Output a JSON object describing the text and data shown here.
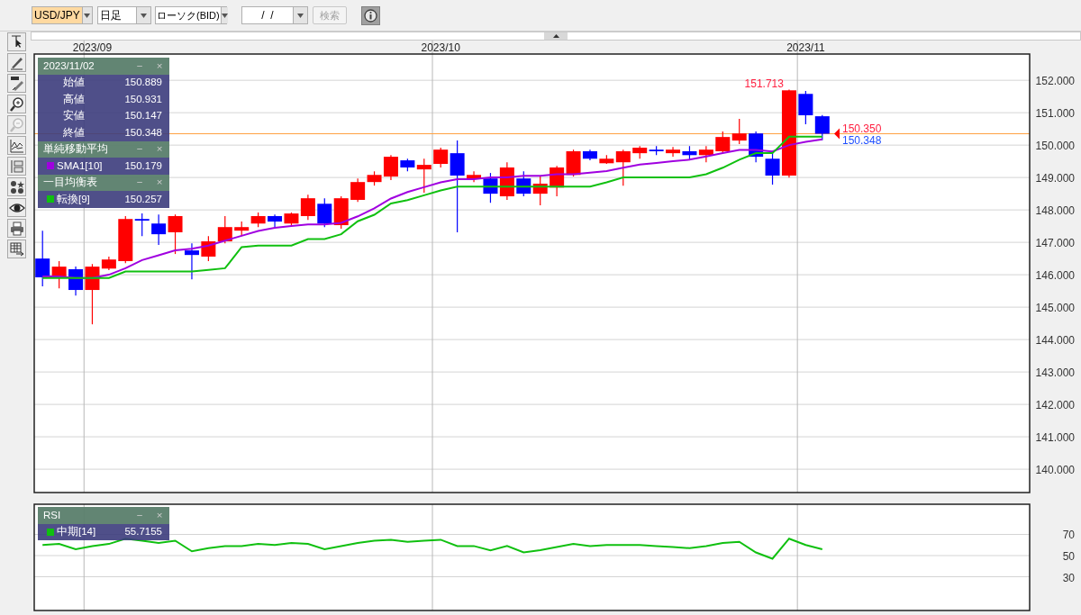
{
  "toolbar": {
    "symbol": "USD/JPY",
    "timeframe": "日足",
    "chart_type": "ローソク(BID)",
    "date": "/  /",
    "search_button": "検索",
    "search_disabled": true
  },
  "price_chart": {
    "legends": [
      {
        "title": "2023/11/02",
        "minimize": "−",
        "close": "×",
        "rows": [
          {
            "kind": "value",
            "label": "始値",
            "value": "150.889"
          },
          {
            "kind": "value",
            "label": "高値",
            "value": "150.931"
          },
          {
            "kind": "value",
            "label": "安値",
            "value": "150.147"
          },
          {
            "kind": "value",
            "label": "終値",
            "value": "150.348"
          }
        ]
      },
      {
        "title": "単純移動平均",
        "minimize": "−",
        "close": "×",
        "rows": [
          {
            "kind": "series",
            "value": "150.179"
          }
        ]
      },
      {
        "title": "一目均衡表",
        "minimize": "−",
        "close": "×",
        "rows": [
          {
            "kind": "series",
            "value": "150.257"
          }
        ]
      }
    ],
    "chart_data": {
      "type": "candlestick",
      "grid": true,
      "ylim": [
        139.28,
        152.81
      ],
      "categories": [
        null,
        null,
        null,
        "2023/09",
        null,
        null,
        null,
        null,
        null,
        null,
        null,
        null,
        null,
        null,
        null,
        null,
        null,
        null,
        null,
        null,
        null,
        null,
        null,
        null,
        "2023/10",
        null,
        null,
        null,
        null,
        null,
        null,
        null,
        null,
        null,
        null,
        null,
        null,
        null,
        null,
        null,
        null,
        null,
        null,
        null,
        null,
        null,
        "2023/11",
        null,
        null,
        null,
        null,
        null,
        null,
        null,
        null,
        null,
        null,
        null,
        null,
        null
      ],
      "yticks": [
        {
          "value": 152,
          "label": "152.000"
        },
        {
          "value": 151,
          "label": "151.000"
        },
        {
          "value": 150,
          "label": "150.000"
        },
        {
          "value": 149,
          "label": "149.000"
        },
        {
          "value": 148,
          "label": "148.000"
        },
        {
          "value": 147,
          "label": "147.000"
        },
        {
          "value": 146,
          "label": "146.000"
        },
        {
          "value": 145,
          "label": "145.000"
        },
        {
          "value": 144,
          "label": "144.000"
        },
        {
          "value": 143,
          "label": "143.000"
        },
        {
          "value": 142,
          "label": "142.000"
        },
        {
          "value": 141,
          "label": "141.000"
        },
        {
          "value": 140,
          "label": "140.000"
        }
      ],
      "ohlc": [
        [
          146.5,
          147.36,
          145.64,
          145.92
        ],
        [
          145.92,
          146.42,
          145.58,
          146.25
        ],
        [
          146.17,
          146.25,
          145.36,
          145.53
        ],
        [
          145.53,
          146.33,
          144.47,
          146.25
        ],
        [
          146.19,
          146.56,
          146.14,
          146.47
        ],
        [
          146.42,
          147.81,
          146.36,
          147.72
        ],
        [
          147.72,
          147.89,
          147.19,
          147.67
        ],
        [
          147.58,
          147.86,
          146.92,
          147.25
        ],
        [
          147.31,
          147.86,
          146.64,
          147.81
        ],
        [
          146.75,
          146.97,
          145.86,
          146.61
        ],
        [
          146.56,
          147.19,
          146.42,
          147.03
        ],
        [
          147.03,
          147.81,
          146.97,
          147.47
        ],
        [
          147.36,
          147.64,
          147.19,
          147.47
        ],
        [
          147.58,
          147.92,
          147.47,
          147.81
        ],
        [
          147.81,
          147.86,
          147.47,
          147.64
        ],
        [
          147.58,
          147.92,
          147.53,
          147.89
        ],
        [
          147.81,
          148.47,
          147.69,
          148.36
        ],
        [
          148.19,
          148.36,
          147.47,
          147.58
        ],
        [
          147.53,
          148.42,
          147.42,
          148.36
        ],
        [
          148.31,
          148.97,
          148.25,
          148.86
        ],
        [
          148.86,
          149.19,
          148.75,
          149.08
        ],
        [
          149.03,
          149.69,
          148.92,
          149.64
        ],
        [
          149.53,
          149.58,
          149.19,
          149.31
        ],
        [
          149.25,
          149.58,
          148.53,
          149.39
        ],
        [
          149.42,
          149.92,
          149.31,
          149.86
        ],
        [
          149.75,
          150.14,
          147.31,
          149.06
        ],
        [
          148.97,
          149.19,
          148.86,
          149.08
        ],
        [
          148.97,
          149.14,
          148.22,
          148.5
        ],
        [
          148.42,
          149.47,
          148.31,
          149.31
        ],
        [
          148.97,
          149.19,
          148.42,
          148.5
        ],
        [
          148.5,
          149.06,
          148.14,
          148.81
        ],
        [
          148.69,
          149.36,
          148.42,
          149.31
        ],
        [
          149.08,
          149.86,
          149.03,
          149.81
        ],
        [
          149.81,
          149.86,
          149.53,
          149.58
        ],
        [
          149.44,
          149.69,
          149.42,
          149.58
        ],
        [
          149.47,
          149.86,
          148.75,
          149.81
        ],
        [
          149.75,
          149.97,
          149.58,
          149.92
        ],
        [
          149.86,
          149.97,
          149.69,
          149.81
        ],
        [
          149.75,
          149.94,
          149.64,
          149.86
        ],
        [
          149.81,
          149.97,
          149.53,
          149.69
        ],
        [
          149.69,
          149.97,
          149.47,
          149.86
        ],
        [
          149.81,
          150.42,
          149.75,
          150.25
        ],
        [
          150.14,
          150.81,
          150.03,
          150.36
        ],
        [
          150.36,
          150.42,
          149.47,
          149.64
        ],
        [
          149.58,
          149.75,
          148.78,
          149.06
        ],
        [
          149.06,
          151.71,
          149.0,
          151.69
        ],
        [
          151.58,
          151.67,
          150.64,
          150.92
        ],
        [
          150.89,
          150.93,
          150.15,
          150.35
        ],
        null,
        null,
        null,
        null,
        null,
        null,
        null,
        null,
        null,
        null,
        null,
        null
      ],
      "series": [
        {
          "name": "SMA1[10]",
          "type": "line",
          "color": "#a000e0",
          "values": [
            145.95,
            145.95,
            145.9,
            145.9,
            146.0,
            146.2,
            146.45,
            146.6,
            146.75,
            146.8,
            146.9,
            147.05,
            147.2,
            147.35,
            147.45,
            147.5,
            147.55,
            147.55,
            147.6,
            147.8,
            148.05,
            148.35,
            148.55,
            148.7,
            148.85,
            148.95,
            148.95,
            149.0,
            149.0,
            149.05,
            149.05,
            149.1,
            149.1,
            149.15,
            149.2,
            149.3,
            149.4,
            149.45,
            149.5,
            149.55,
            149.65,
            149.75,
            149.85,
            149.85,
            149.8,
            150.0,
            150.1,
            150.18,
            null,
            null,
            null,
            null,
            null,
            null,
            null,
            null,
            null,
            null,
            null,
            null
          ]
        },
        {
          "name": "転換[9]",
          "type": "line",
          "color": "#10c010",
          "values": [
            145.9,
            145.9,
            145.9,
            145.9,
            145.9,
            146.1,
            146.1,
            146.1,
            146.1,
            146.1,
            146.15,
            146.2,
            146.85,
            146.9,
            146.9,
            146.9,
            147.1,
            147.1,
            147.25,
            147.65,
            147.85,
            148.2,
            148.3,
            148.45,
            148.6,
            148.72,
            148.72,
            148.72,
            148.72,
            148.72,
            148.72,
            148.72,
            148.72,
            148.72,
            148.85,
            149.0,
            149.0,
            149.0,
            149.0,
            149.0,
            149.1,
            149.3,
            149.55,
            149.75,
            149.75,
            150.26,
            150.26,
            150.26,
            null,
            null,
            null,
            null,
            null,
            null,
            null,
            null,
            null,
            null,
            null,
            null
          ]
        }
      ],
      "ref_lines": [
        {
          "axis": "y",
          "value": 150.35,
          "color": "#ffa040"
        }
      ],
      "annotations": [
        "151.713",
        "150.350",
        "150.348"
      ]
    }
  },
  "rsi_chart": {
    "legends": [
      {
        "title": "RSI",
        "minimize": "−",
        "close": "×",
        "rows": [
          {
            "kind": "series",
            "value": "55.7155"
          }
        ]
      }
    ],
    "chart_data": {
      "type": "line",
      "grid": true,
      "ylim": [
        -1.9,
        98.5
      ],
      "categories": [
        null,
        null,
        null,
        null,
        null,
        null,
        null,
        null,
        null,
        null,
        null,
        null,
        null,
        null,
        null,
        null,
        null,
        null,
        null,
        null,
        null,
        null,
        null,
        null,
        null,
        null,
        null,
        null,
        null,
        null,
        null,
        null,
        null,
        null,
        null,
        null,
        null,
        null,
        null,
        null,
        null,
        null,
        null,
        null,
        null,
        null,
        null,
        null,
        null,
        null,
        null,
        null,
        null,
        null,
        null,
        null,
        null,
        null,
        null,
        null
      ],
      "yticks": [
        {
          "value": 70,
          "label": "70"
        },
        {
          "value": 50,
          "label": "50"
        },
        {
          "value": 30,
          "label": "30"
        }
      ],
      "series": [
        {
          "name": "中期[14]",
          "color": "#10c010",
          "values": [
            60,
            61,
            56,
            59,
            61,
            66,
            64,
            62,
            64,
            54,
            57,
            59,
            59,
            61,
            60,
            62,
            61,
            56,
            59,
            62,
            64,
            65,
            63,
            64,
            65,
            59,
            59,
            55,
            59,
            53,
            55,
            58,
            61,
            59,
            60,
            60,
            60,
            59,
            58,
            57,
            59,
            62,
            63,
            53,
            47,
            66,
            60,
            56,
            null,
            null,
            null,
            null,
            null,
            null,
            null,
            null,
            null,
            null,
            null,
            null
          ]
        }
      ]
    }
  }
}
